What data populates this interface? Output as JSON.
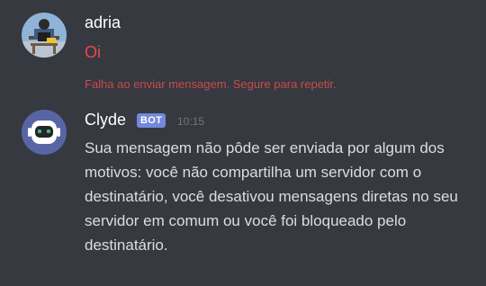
{
  "messages": [
    {
      "author": "adria",
      "text": "Oi",
      "status": "failed",
      "failure_notice": "Falha ao enviar mensagem. Segure para repetir.",
      "avatar_icon": "user-avatar-icon"
    },
    {
      "author": "Clyde",
      "badge": "BOT",
      "timestamp": "10:15",
      "text": "Sua mensagem não pôde ser enviada por algum dos motivos: você não compartilha um servidor com o destinatário, você desativou mensagens diretas no seu servidor em comum ou você foi bloqueado pelo destinatário.",
      "avatar_icon": "clyde-bot-icon"
    }
  ],
  "colors": {
    "background": "#36393f",
    "failed_text": "#f04747",
    "failure_notice": "#c94a4a",
    "bot_badge": "#7289da",
    "clyde_avatar": "#5865a4",
    "timestamp": "#72767d",
    "message_text": "#dcddde"
  }
}
